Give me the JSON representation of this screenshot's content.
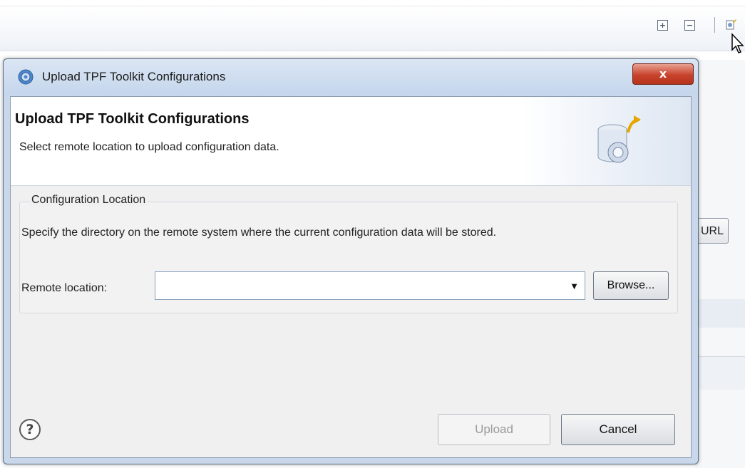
{
  "background": {
    "toolbar": {
      "expand_icon": "plus-box-icon",
      "collapse_icon": "minus-box-icon",
      "action_icon": "configure-icon"
    },
    "url_button_label": "URL"
  },
  "dialog": {
    "title": "Upload TPF Toolkit Configurations",
    "close_label": "x",
    "header": {
      "title": "Upload TPF Toolkit Configurations",
      "description": "Select remote location to upload configuration data."
    },
    "group": {
      "label": "Configuration Location",
      "description": "Specify the directory on the remote system where the current configuration data will be stored.",
      "remote_location_label": "Remote location:",
      "remote_location_value": "",
      "browse_label": "Browse..."
    },
    "help_label": "?",
    "upload_label": "Upload",
    "cancel_label": "Cancel"
  },
  "colors": {
    "title_bar": "#c5d6ec",
    "close_button": "#c8432c",
    "disabled_text": "#9a9a9a"
  }
}
